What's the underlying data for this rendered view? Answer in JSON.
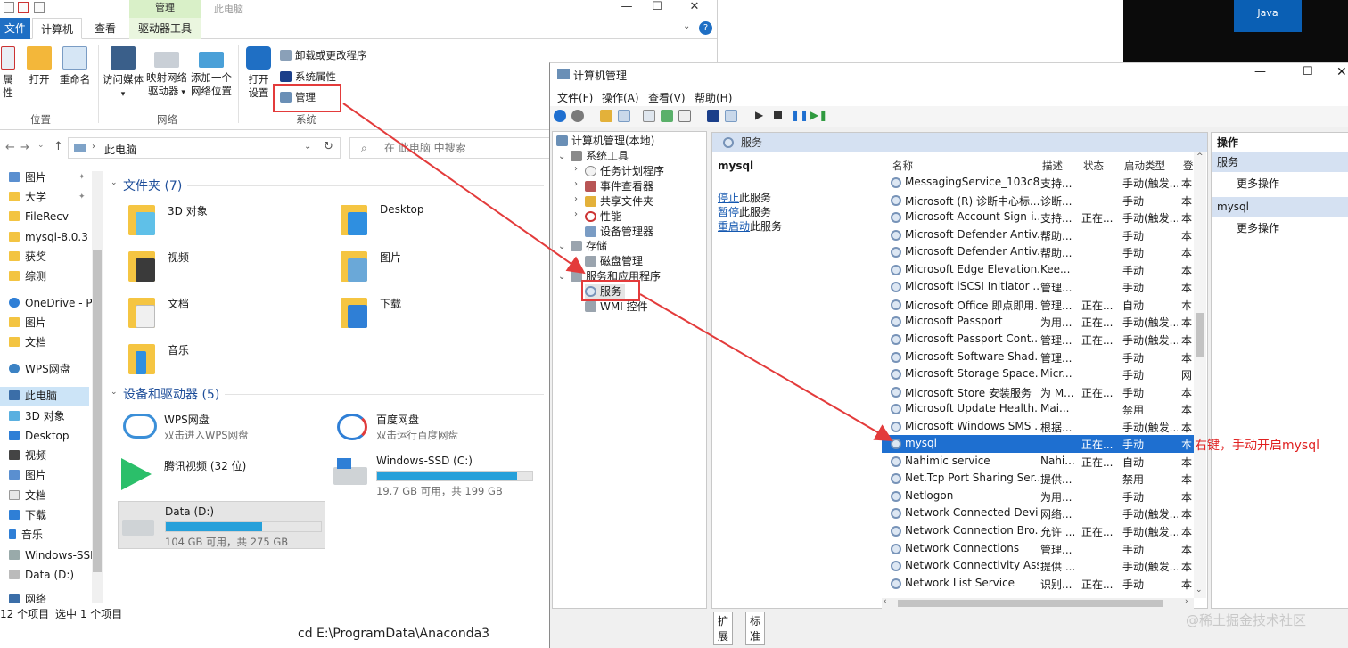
{
  "explorer": {
    "title": "此电脑",
    "context_group": "管理",
    "tabs": {
      "file": "文件",
      "computer": "计算机",
      "view": "查看",
      "drive_tools": "驱动器工具"
    },
    "ribbon": {
      "properties": "属性",
      "open": "打开",
      "rename": "重命名",
      "access_media": "访问媒体",
      "map_drive_1": "映射网络",
      "map_drive_2": "驱动器",
      "add_location_1": "添加一个",
      "add_location_2": "网络位置",
      "open_settings_1": "打开",
      "open_settings_2": "设置",
      "uninstall": "卸载或更改程序",
      "system_properties": "系统属性",
      "manage": "管理",
      "group_location": "位置",
      "group_network": "网络",
      "group_system": "系统"
    },
    "address": "此电脑",
    "search_placeholder": "在 此电脑 中搜索",
    "nav": [
      {
        "label": "图片",
        "pinned": true
      },
      {
        "label": "大学",
        "pinned": true
      },
      {
        "label": "FileRecv"
      },
      {
        "label": "mysql-8.0.31-"
      },
      {
        "label": "获奖"
      },
      {
        "label": "综测"
      },
      {
        "label": "OneDrive - Per"
      },
      {
        "label": "图片"
      },
      {
        "label": "文档"
      },
      {
        "label": "WPS网盘"
      },
      {
        "label": "此电脑"
      },
      {
        "label": "3D 对象"
      },
      {
        "label": "Desktop"
      },
      {
        "label": "视频"
      },
      {
        "label": "图片"
      },
      {
        "label": "文档"
      },
      {
        "label": "下载"
      },
      {
        "label": "音乐"
      },
      {
        "label": "Windows-SSI"
      },
      {
        "label": "Data (D:)"
      },
      {
        "label": "网络"
      }
    ],
    "folders_header": "文件夹 (7)",
    "folders": [
      "3D 对象",
      "Desktop",
      "视频",
      "图片",
      "文档",
      "下载",
      "音乐"
    ],
    "devices_header": "设备和驱动器 (5)",
    "devices": [
      {
        "name": "WPS网盘",
        "sub": "双击进入WPS网盘"
      },
      {
        "name": "百度网盘",
        "sub": "双击运行百度网盘"
      },
      {
        "name": "腾讯视频 (32 位)",
        "sub": ""
      },
      {
        "name": "Windows-SSD (C:)",
        "sub": "19.7 GB 可用，共 199 GB",
        "used_fraction": 0.9
      },
      {
        "name": "Data (D:)",
        "sub": "104 GB 可用，共 275 GB",
        "used_fraction": 0.62
      }
    ],
    "status_count": "12 个项目",
    "status_selected": "选中 1 个项目"
  },
  "cmdline": "cd E:\\ProgramData\\Anaconda3",
  "cm": {
    "title": "计算机管理",
    "menu": [
      "文件(F)",
      "操作(A)",
      "查看(V)",
      "帮助(H)"
    ],
    "tree": {
      "root": "计算机管理(本地)",
      "system_tools": "系统工具",
      "task_scheduler": "任务计划程序",
      "event_viewer": "事件查看器",
      "shared_folders": "共享文件夹",
      "performance": "性能",
      "device_manager": "设备管理器",
      "storage": "存储",
      "disk_management": "磁盘管理",
      "services_apps": "服务和应用程序",
      "services": "服务",
      "wmi": "WMI 控件"
    },
    "mid_header": "服务",
    "selected_service": "mysql",
    "stop_link": "停止",
    "stop_suffix": "此服务",
    "pause_link": "暂停",
    "pause_suffix": "此服务",
    "restart_link": "重启动",
    "restart_suffix": "此服务",
    "columns": {
      "name": "名称",
      "desc": "描述",
      "status": "状态",
      "startup": "启动类型",
      "logon": "登"
    },
    "services": [
      {
        "name": "MessagingService_103c8...",
        "desc": "支持...",
        "status": "",
        "startup": "手动(触发...",
        "logon": "本"
      },
      {
        "name": "Microsoft (R) 诊断中心标...",
        "desc": "诊断...",
        "status": "",
        "startup": "手动",
        "logon": "本"
      },
      {
        "name": "Microsoft Account Sign-i...",
        "desc": "支持...",
        "status": "正在...",
        "startup": "手动(触发...",
        "logon": "本"
      },
      {
        "name": "Microsoft Defender Antiv...",
        "desc": "帮助...",
        "status": "",
        "startup": "手动",
        "logon": "本"
      },
      {
        "name": "Microsoft Defender Antiv...",
        "desc": "帮助...",
        "status": "",
        "startup": "手动",
        "logon": "本"
      },
      {
        "name": "Microsoft Edge Elevation...",
        "desc": "Kee...",
        "status": "",
        "startup": "手动",
        "logon": "本"
      },
      {
        "name": "Microsoft iSCSI Initiator ...",
        "desc": "管理...",
        "status": "",
        "startup": "手动",
        "logon": "本"
      },
      {
        "name": "Microsoft Office 即点即用...",
        "desc": "管理...",
        "status": "正在...",
        "startup": "自动",
        "logon": "本"
      },
      {
        "name": "Microsoft Passport",
        "desc": "为用...",
        "status": "正在...",
        "startup": "手动(触发...",
        "logon": "本"
      },
      {
        "name": "Microsoft Passport Cont...",
        "desc": "管理...",
        "status": "正在...",
        "startup": "手动(触发...",
        "logon": "本"
      },
      {
        "name": "Microsoft Software Shad...",
        "desc": "管理...",
        "status": "",
        "startup": "手动",
        "logon": "本"
      },
      {
        "name": "Microsoft Storage Space...",
        "desc": "Micr...",
        "status": "",
        "startup": "手动",
        "logon": "网"
      },
      {
        "name": "Microsoft Store 安装服务",
        "desc": "为 M...",
        "status": "正在...",
        "startup": "手动",
        "logon": "本"
      },
      {
        "name": "Microsoft Update Health...",
        "desc": "Mai...",
        "status": "",
        "startup": "禁用",
        "logon": "本"
      },
      {
        "name": "Microsoft Windows SMS ...",
        "desc": "根据...",
        "status": "",
        "startup": "手动(触发...",
        "logon": "本"
      },
      {
        "name": "mysql",
        "desc": "",
        "status": "正在...",
        "startup": "手动",
        "logon": "本"
      },
      {
        "name": "Nahimic service",
        "desc": "Nahi...",
        "status": "正在...",
        "startup": "自动",
        "logon": "本"
      },
      {
        "name": "Net.Tcp Port Sharing Ser...",
        "desc": "提供...",
        "status": "",
        "startup": "禁用",
        "logon": "本"
      },
      {
        "name": "Netlogon",
        "desc": "为用...",
        "status": "",
        "startup": "手动",
        "logon": "本"
      },
      {
        "name": "Network Connected Devi...",
        "desc": "网络...",
        "status": "",
        "startup": "手动(触发...",
        "logon": "本"
      },
      {
        "name": "Network Connection Bro...",
        "desc": "允许 ...",
        "status": "正在...",
        "startup": "手动(触发...",
        "logon": "本"
      },
      {
        "name": "Network Connections",
        "desc": "管理...",
        "status": "",
        "startup": "手动",
        "logon": "本"
      },
      {
        "name": "Network Connectivity Ass...",
        "desc": "提供 ...",
        "status": "",
        "startup": "手动(触发...",
        "logon": "本"
      },
      {
        "name": "Network List Service",
        "desc": "识别...",
        "status": "正在...",
        "startup": "手动",
        "logon": "本"
      }
    ],
    "bottom_tabs": [
      "扩展",
      "标准"
    ],
    "actions": {
      "head1": "操作",
      "sec1": "服务",
      "more1": "更多操作",
      "sec2": "mysql",
      "more2": "更多操作"
    }
  },
  "annotation": "右键，手动开启mysql",
  "watermark": "@稀土掘金技术社区",
  "java_tile": "Java"
}
